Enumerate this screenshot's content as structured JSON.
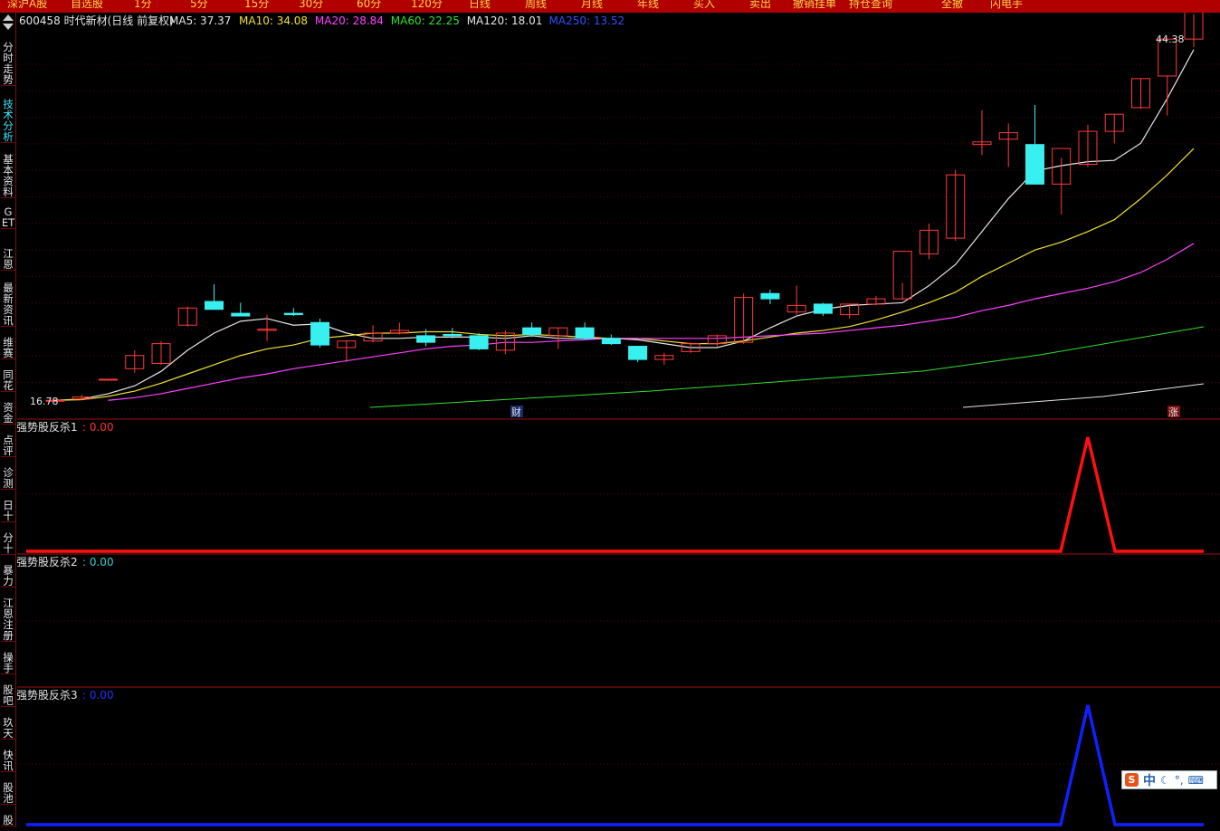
{
  "topbar": {
    "items": [
      "深沪A股",
      "自选股",
      "1分",
      "5分",
      "15分",
      "30分",
      "60分",
      "120分",
      "日线",
      "周线",
      "月线",
      "年线",
      "买入",
      "卖出",
      "撤销挂单",
      "持仓查询",
      "全撤",
      "闪电手"
    ]
  },
  "sidebar": {
    "items": [
      "分时走势",
      "技术分析",
      "基本资料",
      "GET",
      "江恩",
      "最新资讯",
      "维赛",
      "同花",
      "资金",
      "点评",
      "诊测",
      "日十",
      "分十",
      "暴力",
      "江恩注册",
      "操手",
      "股吧",
      "玖天",
      "快讯",
      "股池",
      "股"
    ],
    "active_index": 1
  },
  "main_panel": {
    "stock": "600458 时代新材(日线 前复权)",
    "ma_labels": [
      {
        "text": "MA5: 37.37",
        "color": "#e6e6e6"
      },
      {
        "text": "MA10: 34.08",
        "color": "#f0e030"
      },
      {
        "text": "MA20: 28.84",
        "color": "#ff40ff"
      },
      {
        "text": "MA60: 22.25",
        "color": "#30e030"
      },
      {
        "text": "MA120: 18.01",
        "color": "#e6e6e6"
      },
      {
        "text": "MA250: 13.52",
        "color": "#3050ff"
      }
    ],
    "high_label": "44.38",
    "low_label": "16.78",
    "markers": [
      "财",
      "涨"
    ]
  },
  "indicators": [
    {
      "name": "强势股反杀1",
      "value": ": 0.00",
      "name_color": "#e6e6e6",
      "value_color": "#ff3030",
      "line_color": "#ff1010",
      "peak_index": 39
    },
    {
      "name": "强势股反杀2",
      "value": ": 0.00",
      "name_color": "#e6e6e6",
      "value_color": "#30d0d0",
      "line_color": "#30d0d0",
      "peak_index": null
    },
    {
      "name": "强势股反杀3",
      "value": ": 0.00",
      "name_color": "#e6e6e6",
      "value_color": "#2030ff",
      "line_color": "#1020ff",
      "peak_index": 39
    }
  ],
  "chart_data": {
    "type": "candlestick",
    "ohlc": [
      [
        16.9,
        17.0,
        16.8,
        16.9
      ],
      [
        17.0,
        17.35,
        16.95,
        17.15
      ],
      [
        18.5,
        18.5,
        18.5,
        18.5
      ],
      [
        19.3,
        20.7,
        19.0,
        20.3
      ],
      [
        19.7,
        21.4,
        19.6,
        21.2
      ],
      [
        22.6,
        24.0,
        22.5,
        23.9
      ],
      [
        24.4,
        25.7,
        24.4,
        23.8
      ],
      [
        23.5,
        24.3,
        23.3,
        23.3
      ],
      [
        22.2,
        23.4,
        21.4,
        22.3
      ],
      [
        23.5,
        23.9,
        23.3,
        23.4
      ],
      [
        22.8,
        23.1,
        20.9,
        21.1
      ],
      [
        20.9,
        21.4,
        19.8,
        21.4
      ],
      [
        21.4,
        22.6,
        21.3,
        22.0
      ],
      [
        22.0,
        22.8,
        21.9,
        22.2
      ],
      [
        21.8,
        22.3,
        21.0,
        21.3
      ],
      [
        21.9,
        22.4,
        21.6,
        21.8
      ],
      [
        21.8,
        22.0,
        20.7,
        20.8
      ],
      [
        20.7,
        22.2,
        20.4,
        22.0
      ],
      [
        22.4,
        22.8,
        21.7,
        21.9
      ],
      [
        21.8,
        22.4,
        20.8,
        22.4
      ],
      [
        22.4,
        22.8,
        21.5,
        21.6
      ],
      [
        21.6,
        21.9,
        21.1,
        21.2
      ],
      [
        21.0,
        21.0,
        19.8,
        20.0
      ],
      [
        20.0,
        20.5,
        19.6,
        20.3
      ],
      [
        20.6,
        21.3,
        20.5,
        21.2
      ],
      [
        21.2,
        21.9,
        21.0,
        21.8
      ],
      [
        21.3,
        25.0,
        21.2,
        24.7
      ],
      [
        25.0,
        25.3,
        24.2,
        24.6
      ],
      [
        23.6,
        25.6,
        23.4,
        24.1
      ],
      [
        24.2,
        24.3,
        23.3,
        23.5
      ],
      [
        23.4,
        24.2,
        23.1,
        24.2
      ],
      [
        24.2,
        24.8,
        24.1,
        24.6
      ],
      [
        24.6,
        25.8,
        24.5,
        28.2
      ],
      [
        28.0,
        30.3,
        27.6,
        29.8
      ],
      [
        29.2,
        34.4,
        29.0,
        34.0
      ],
      [
        36.3,
        38.9,
        35.5,
        36.5
      ],
      [
        36.7,
        37.9,
        34.6,
        37.2
      ],
      [
        36.3,
        39.3,
        33.4,
        33.3
      ],
      [
        33.3,
        35.3,
        31.0,
        36.0
      ],
      [
        34.8,
        37.8,
        34.6,
        37.3
      ],
      [
        37.3,
        38.6,
        36.4,
        38.6
      ],
      [
        39.1,
        41.3,
        39.0,
        41.3
      ],
      [
        41.5,
        41.5,
        38.5,
        44.3
      ],
      [
        44.3,
        46.2,
        43.7,
        47.4
      ]
    ],
    "ma": {
      "MA5": [
        16.9,
        17.0,
        17.4,
        18.0,
        19.1,
        20.7,
        22.0,
        22.9,
        23.1,
        22.6,
        22.7,
        22.0,
        21.6,
        21.6,
        21.7,
        21.7,
        21.7,
        21.6,
        21.8,
        21.6,
        21.6,
        21.6,
        21.5,
        21.2,
        20.9,
        20.9,
        21.4,
        22.4,
        23.3,
        23.8,
        24.1,
        24.2,
        24.3,
        25.6,
        27.2,
        29.7,
        32.2,
        34.3,
        34.7,
        35.0,
        35.1,
        36.4,
        39.8,
        43.5
      ],
      "MA10": [
        16.9,
        16.95,
        17.2,
        17.6,
        18.2,
        18.9,
        19.6,
        20.3,
        20.8,
        21.1,
        21.6,
        21.8,
        22.0,
        22.0,
        22.1,
        22.1,
        21.9,
        21.8,
        21.9,
        21.8,
        21.7,
        21.6,
        21.6,
        21.4,
        21.2,
        21.2,
        21.4,
        21.7,
        22.0,
        22.2,
        22.5,
        23.0,
        23.6,
        24.3,
        25.1,
        26.3,
        27.3,
        28.3,
        28.9,
        29.7,
        30.6,
        32.2,
        34.0,
        36.0
      ],
      "MA20": [
        null,
        null,
        16.9,
        17.1,
        17.4,
        17.8,
        18.2,
        18.6,
        18.9,
        19.3,
        19.6,
        19.9,
        20.2,
        20.5,
        20.8,
        21.0,
        21.1,
        21.3,
        21.3,
        21.4,
        21.5,
        21.6,
        21.6,
        21.6,
        21.6,
        21.6,
        21.7,
        21.8,
        21.9,
        22.0,
        22.2,
        22.4,
        22.6,
        22.9,
        23.2,
        23.7,
        24.1,
        24.6,
        25.0,
        25.4,
        25.9,
        26.6,
        27.6,
        28.8
      ]
    },
    "y_range": [
      16.78,
      44.38
    ]
  }
}
